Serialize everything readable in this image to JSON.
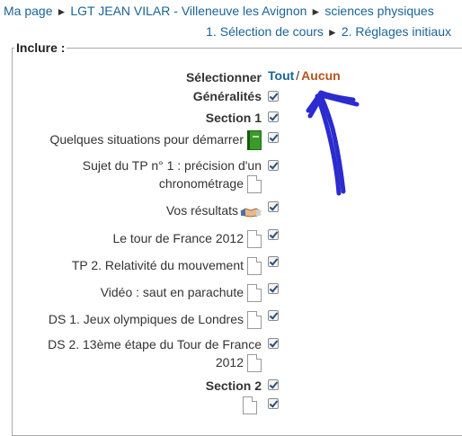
{
  "breadcrumb": {
    "items": [
      "Ma page",
      "LGT JEAN VILAR - Villeneuve les Avignon",
      "sciences physiques"
    ],
    "separator": "►"
  },
  "steps": {
    "items": [
      "1. Sélection de cours",
      "2. Réglages initiaux"
    ],
    "separator": "►"
  },
  "include": {
    "legend": "Inclure :",
    "select_label": "Sélectionner",
    "select_all": "Tout",
    "select_separator": "/",
    "select_none": "Aucun",
    "items": [
      {
        "label": "Généralités",
        "icon": "none",
        "checked": true
      },
      {
        "label": "Section 1",
        "icon": "none",
        "checked": true
      },
      {
        "label": "Quelques situations pour démarrer",
        "icon": "green-book-icon",
        "checked": true
      },
      {
        "label_line1": "Sujet du TP n° 1 : précision d'un",
        "label_line2": "chronométrage",
        "icon": "document-icon",
        "checked": true
      },
      {
        "label": "Vos résultats",
        "icon": "handshake-icon",
        "checked": true
      },
      {
        "label": "Le tour de France 2012",
        "icon": "document-icon",
        "checked": true
      },
      {
        "label": "TP 2. Relativité du mouvement",
        "icon": "document-icon",
        "checked": true
      },
      {
        "label": "Vidéo : saut en parachute",
        "icon": "document-icon",
        "checked": true
      },
      {
        "label": "DS 1. Jeux olympiques de Londres",
        "icon": "document-icon",
        "checked": true
      },
      {
        "label_line1": "DS 2. 13ème étape du Tour de France",
        "label_line2": "2012",
        "icon": "document-icon",
        "checked": true
      },
      {
        "label": "Section 2",
        "icon": "none",
        "checked": true
      }
    ]
  },
  "colors": {
    "link": "#1a6496",
    "none_link": "#b8521c",
    "annotation_arrow": "#1a1acc"
  }
}
